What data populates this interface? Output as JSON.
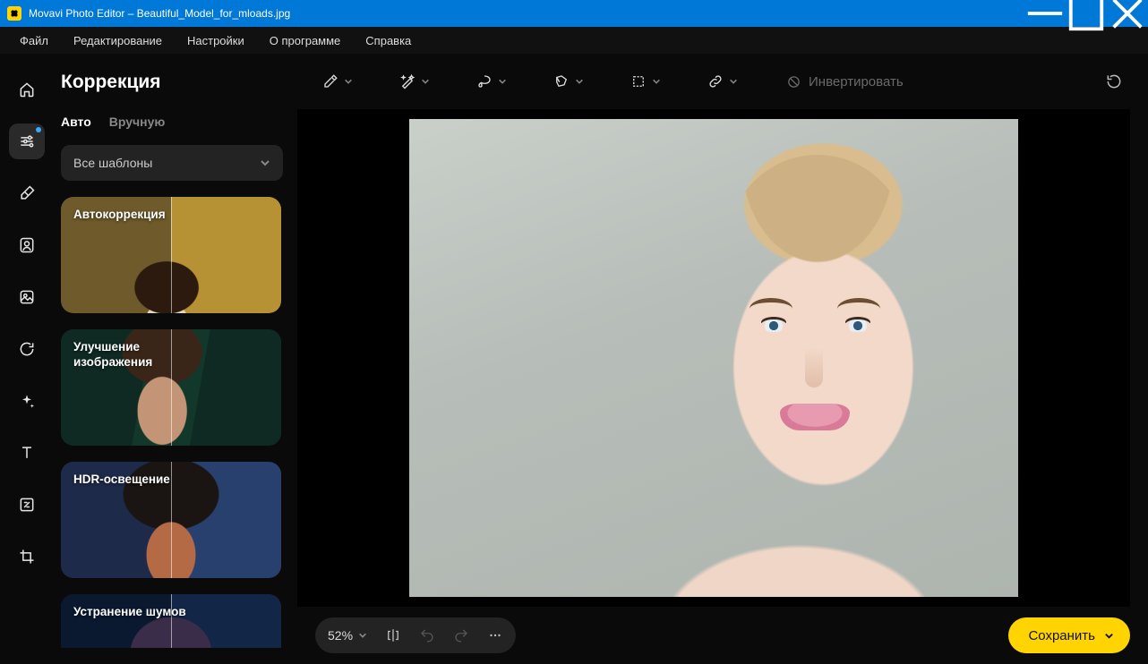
{
  "window": {
    "title": "Movavi Photo Editor – Beautiful_Model_for_mloads.jpg"
  },
  "menubar": {
    "items": [
      "Файл",
      "Редактирование",
      "Настройки",
      "О программе",
      "Справка"
    ]
  },
  "rail": {
    "icons": [
      "home-icon",
      "sliders-icon",
      "eraser-icon",
      "portrait-icon",
      "effects-icon",
      "refresh-icon",
      "sparkle-icon",
      "text-icon",
      "resize-icon",
      "crop-icon"
    ],
    "active_index": 1
  },
  "panel": {
    "title": "Коррекция",
    "tabs": {
      "auto": "Авто",
      "manual": "Вручную",
      "active": "auto"
    },
    "select": {
      "label": "Все шаблоны"
    },
    "presets": [
      {
        "label": "Автокоррекция"
      },
      {
        "label": "Улучшение изображения"
      },
      {
        "label": "HDR-освещение"
      },
      {
        "label": "Устранение шумов"
      }
    ]
  },
  "toolbar": {
    "tools": [
      "eyedropper-icon",
      "magic-wand-icon",
      "lasso-icon",
      "polygon-lasso-icon",
      "marquee-icon",
      "link-icon"
    ],
    "invert_label": "Инвертировать"
  },
  "bottom": {
    "zoom": "52%",
    "save_label": "Сохранить"
  }
}
